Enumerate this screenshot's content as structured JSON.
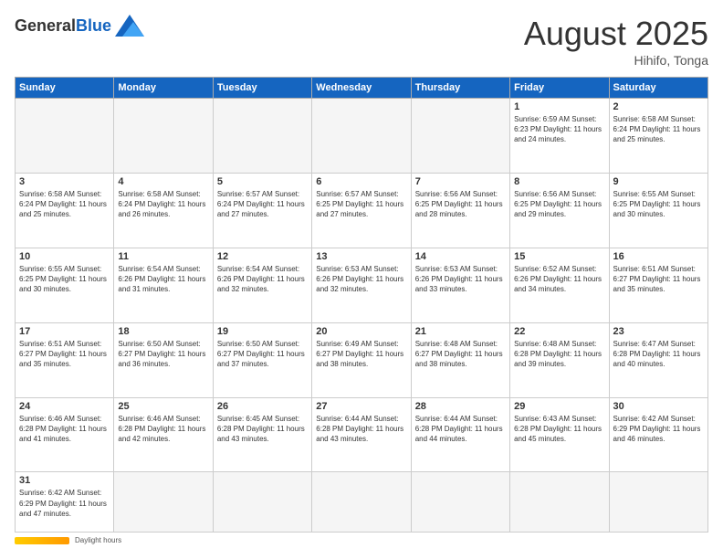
{
  "logo": {
    "general": "General",
    "blue": "Blue"
  },
  "title": "August 2025",
  "location": "Hihifo, Tonga",
  "days_of_week": [
    "Sunday",
    "Monday",
    "Tuesday",
    "Wednesday",
    "Thursday",
    "Friday",
    "Saturday"
  ],
  "footer": {
    "daylight_label": "Daylight hours"
  },
  "weeks": [
    [
      {
        "day": "",
        "info": ""
      },
      {
        "day": "",
        "info": ""
      },
      {
        "day": "",
        "info": ""
      },
      {
        "day": "",
        "info": ""
      },
      {
        "day": "",
        "info": ""
      },
      {
        "day": "1",
        "info": "Sunrise: 6:59 AM\nSunset: 6:23 PM\nDaylight: 11 hours\nand 24 minutes."
      },
      {
        "day": "2",
        "info": "Sunrise: 6:58 AM\nSunset: 6:24 PM\nDaylight: 11 hours\nand 25 minutes."
      }
    ],
    [
      {
        "day": "3",
        "info": "Sunrise: 6:58 AM\nSunset: 6:24 PM\nDaylight: 11 hours\nand 25 minutes."
      },
      {
        "day": "4",
        "info": "Sunrise: 6:58 AM\nSunset: 6:24 PM\nDaylight: 11 hours\nand 26 minutes."
      },
      {
        "day": "5",
        "info": "Sunrise: 6:57 AM\nSunset: 6:24 PM\nDaylight: 11 hours\nand 27 minutes."
      },
      {
        "day": "6",
        "info": "Sunrise: 6:57 AM\nSunset: 6:25 PM\nDaylight: 11 hours\nand 27 minutes."
      },
      {
        "day": "7",
        "info": "Sunrise: 6:56 AM\nSunset: 6:25 PM\nDaylight: 11 hours\nand 28 minutes."
      },
      {
        "day": "8",
        "info": "Sunrise: 6:56 AM\nSunset: 6:25 PM\nDaylight: 11 hours\nand 29 minutes."
      },
      {
        "day": "9",
        "info": "Sunrise: 6:55 AM\nSunset: 6:25 PM\nDaylight: 11 hours\nand 30 minutes."
      }
    ],
    [
      {
        "day": "10",
        "info": "Sunrise: 6:55 AM\nSunset: 6:25 PM\nDaylight: 11 hours\nand 30 minutes."
      },
      {
        "day": "11",
        "info": "Sunrise: 6:54 AM\nSunset: 6:26 PM\nDaylight: 11 hours\nand 31 minutes."
      },
      {
        "day": "12",
        "info": "Sunrise: 6:54 AM\nSunset: 6:26 PM\nDaylight: 11 hours\nand 32 minutes."
      },
      {
        "day": "13",
        "info": "Sunrise: 6:53 AM\nSunset: 6:26 PM\nDaylight: 11 hours\nand 32 minutes."
      },
      {
        "day": "14",
        "info": "Sunrise: 6:53 AM\nSunset: 6:26 PM\nDaylight: 11 hours\nand 33 minutes."
      },
      {
        "day": "15",
        "info": "Sunrise: 6:52 AM\nSunset: 6:26 PM\nDaylight: 11 hours\nand 34 minutes."
      },
      {
        "day": "16",
        "info": "Sunrise: 6:51 AM\nSunset: 6:27 PM\nDaylight: 11 hours\nand 35 minutes."
      }
    ],
    [
      {
        "day": "17",
        "info": "Sunrise: 6:51 AM\nSunset: 6:27 PM\nDaylight: 11 hours\nand 35 minutes."
      },
      {
        "day": "18",
        "info": "Sunrise: 6:50 AM\nSunset: 6:27 PM\nDaylight: 11 hours\nand 36 minutes."
      },
      {
        "day": "19",
        "info": "Sunrise: 6:50 AM\nSunset: 6:27 PM\nDaylight: 11 hours\nand 37 minutes."
      },
      {
        "day": "20",
        "info": "Sunrise: 6:49 AM\nSunset: 6:27 PM\nDaylight: 11 hours\nand 38 minutes."
      },
      {
        "day": "21",
        "info": "Sunrise: 6:48 AM\nSunset: 6:27 PM\nDaylight: 11 hours\nand 38 minutes."
      },
      {
        "day": "22",
        "info": "Sunrise: 6:48 AM\nSunset: 6:28 PM\nDaylight: 11 hours\nand 39 minutes."
      },
      {
        "day": "23",
        "info": "Sunrise: 6:47 AM\nSunset: 6:28 PM\nDaylight: 11 hours\nand 40 minutes."
      }
    ],
    [
      {
        "day": "24",
        "info": "Sunrise: 6:46 AM\nSunset: 6:28 PM\nDaylight: 11 hours\nand 41 minutes."
      },
      {
        "day": "25",
        "info": "Sunrise: 6:46 AM\nSunset: 6:28 PM\nDaylight: 11 hours\nand 42 minutes."
      },
      {
        "day": "26",
        "info": "Sunrise: 6:45 AM\nSunset: 6:28 PM\nDaylight: 11 hours\nand 43 minutes."
      },
      {
        "day": "27",
        "info": "Sunrise: 6:44 AM\nSunset: 6:28 PM\nDaylight: 11 hours\nand 43 minutes."
      },
      {
        "day": "28",
        "info": "Sunrise: 6:44 AM\nSunset: 6:28 PM\nDaylight: 11 hours\nand 44 minutes."
      },
      {
        "day": "29",
        "info": "Sunrise: 6:43 AM\nSunset: 6:28 PM\nDaylight: 11 hours\nand 45 minutes."
      },
      {
        "day": "30",
        "info": "Sunrise: 6:42 AM\nSunset: 6:29 PM\nDaylight: 11 hours\nand 46 minutes."
      }
    ],
    [
      {
        "day": "31",
        "info": "Sunrise: 6:42 AM\nSunset: 6:29 PM\nDaylight: 11 hours\nand 47 minutes."
      },
      {
        "day": "",
        "info": ""
      },
      {
        "day": "",
        "info": ""
      },
      {
        "day": "",
        "info": ""
      },
      {
        "day": "",
        "info": ""
      },
      {
        "day": "",
        "info": ""
      },
      {
        "day": "",
        "info": ""
      }
    ]
  ]
}
